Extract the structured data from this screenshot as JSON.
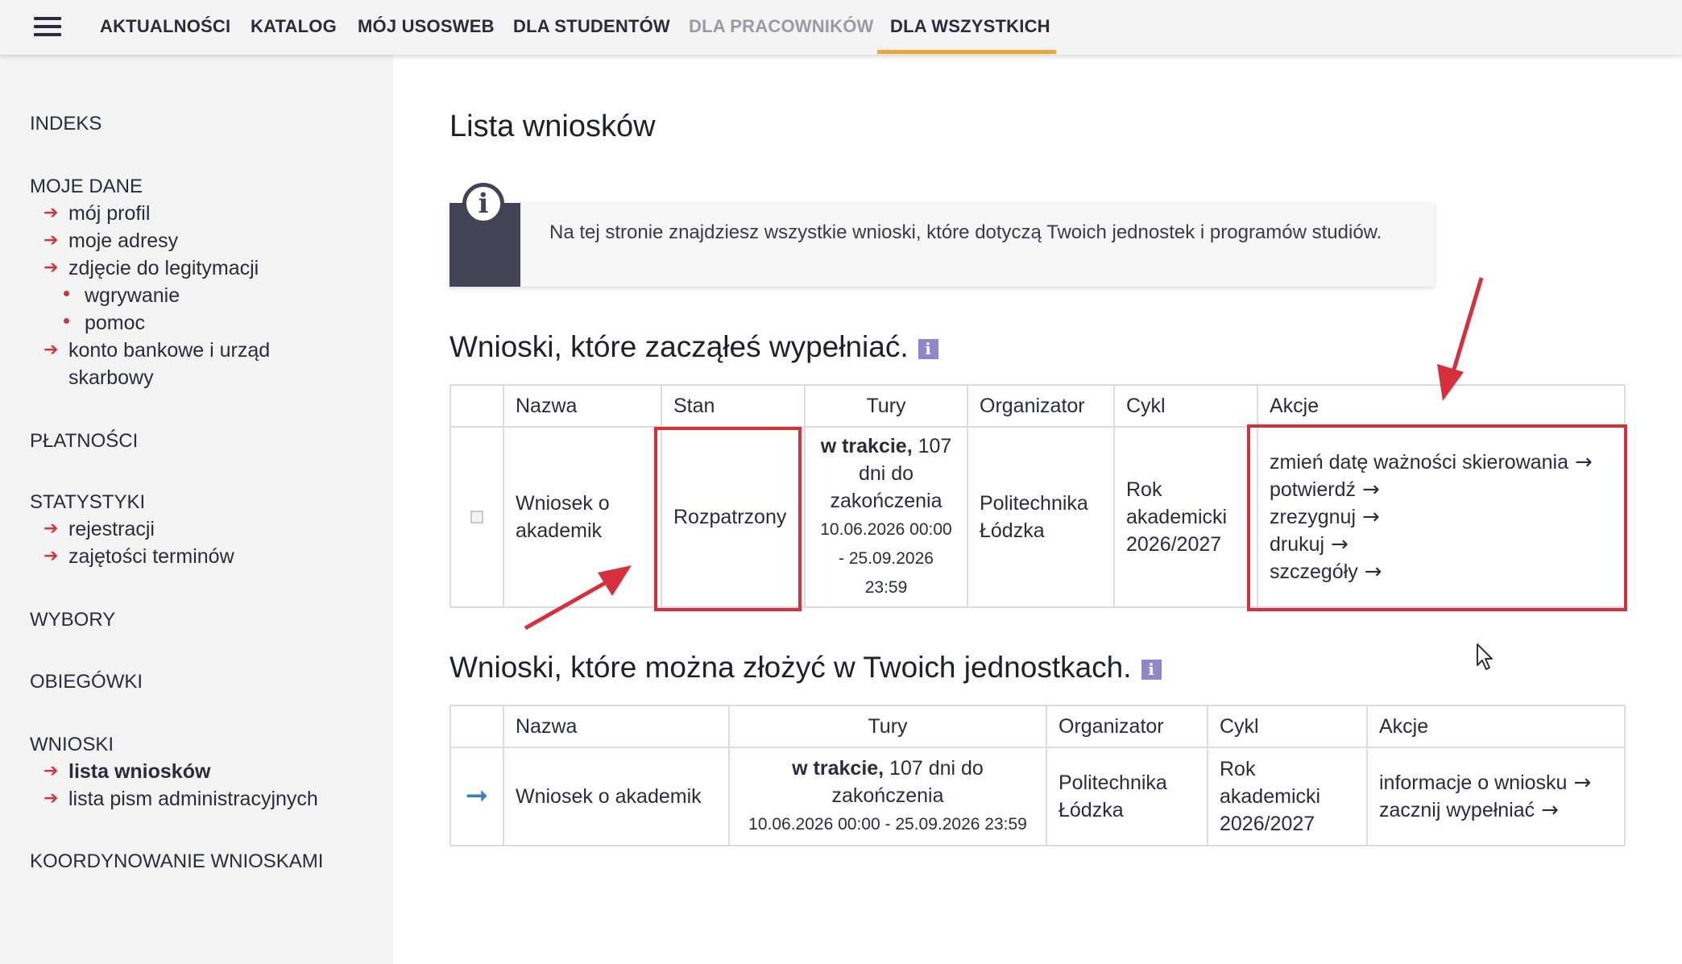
{
  "topnav": {
    "items": [
      "AKTUALNOŚCI",
      "KATALOG",
      "MÓJ USOSWEB",
      "DLA STUDENTÓW",
      "DLA PRACOWNIKÓW",
      "DLA WSZYSTKICH"
    ]
  },
  "sidebar": {
    "indeks": "INDEKS",
    "moje_dane": "MOJE DANE",
    "moj_profil": "mój profil",
    "moje_adresy": "moje adresy",
    "zdjecie": "zdjęcie do legitymacji",
    "wgrywanie": "wgrywanie",
    "pomoc": "pomoc",
    "konto_1": "konto bankowe i urząd",
    "konto_2": "skarbowy",
    "platnosci": "PŁATNOŚCI",
    "statystyki": "STATYSTYKI",
    "rejestracji": "rejestracji",
    "zajetosci": "zajętości terminów",
    "wybory": "WYBORY",
    "obiegowki": "OBIEGÓWKI",
    "wnioski": "WNIOSKI",
    "lista_wnioskow": "lista wniosków",
    "lista_pism": "lista pism administracyjnych",
    "koordynowanie": "KOORDYNOWANIE WNIOSKAMI"
  },
  "main": {
    "title": "Lista wniosków",
    "info_text": "Na tej stronie znajdziesz wszystkie wnioski, które dotyczą Twoich jednostek i programów studiów.",
    "section1_title": "Wnioski, które zacząłeś wypełniać.",
    "section2_title": "Wnioski, które można złożyć w Twoich jednostkach.",
    "info_glyph": "i"
  },
  "table1": {
    "headers": [
      "Nazwa",
      "Stan",
      "Tury",
      "Organizator",
      "Cykl",
      "Akcje"
    ],
    "row": {
      "nazwa": "Wniosek o akademik",
      "stan": "Rozpatrzony",
      "tury_bold": "w trakcie,",
      "tury_rest": " 107 dni do zakończenia",
      "tury_dates": "10.06.2026 00:00 - 25.09.2026 23:59",
      "organizator": "Politechnika Łódzka",
      "cykl": "Rok akademicki 2026/2027",
      "akcje": [
        "zmień datę ważności skierowania",
        "potwierdź",
        "zrezygnuj",
        "drukuj",
        "szczegóły"
      ]
    }
  },
  "table2": {
    "headers": [
      "Nazwa",
      "Tury",
      "Organizator",
      "Cykl",
      "Akcje"
    ],
    "row": {
      "nazwa": "Wniosek o akademik",
      "tury_bold": "w trakcie,",
      "tury_rest": " 107 dni do zakończenia",
      "tury_dates": "10.06.2026 00:00 - 25.09.2026 23:59",
      "organizator": "Politechnika Łódzka",
      "cykl": "Rok akademicki 2026/2027",
      "akcje": [
        "informacje o wniosku",
        "zacznij wypełniać"
      ]
    }
  },
  "icons": {
    "arrow_right": "→",
    "sidebar_arrow": "➔",
    "row_arrow": "➞"
  },
  "colors": {
    "accent_underline": "#f0a53a",
    "highlight_red": "#d7303c",
    "sidebar_bg": "#f3f3f3",
    "info_block": "#434356"
  }
}
